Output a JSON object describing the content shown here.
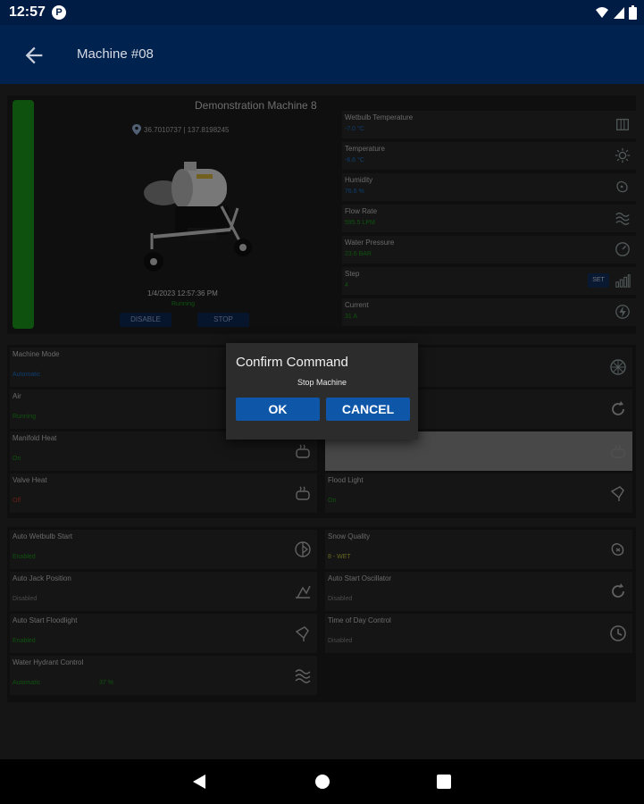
{
  "status_bar": {
    "time": "12:57",
    "app_badge": "P"
  },
  "app_bar": {
    "title": "Machine #08"
  },
  "machine": {
    "name": "Demonstration Machine 8",
    "coordinates": "36.7010737 | 137.8198245",
    "datetime": "1/4/2023 12:57:36 PM",
    "status": "Running",
    "disable_label": "DISABLE",
    "stop_label": "STOP"
  },
  "sensors": [
    {
      "label": "Wetbulb Temperature",
      "value": "-7.0 °C",
      "icon": "snowflake-icon",
      "color": "#1976d2"
    },
    {
      "label": "Temperature",
      "value": "-6.6 °C",
      "icon": "sun-icon",
      "color": "#1976d2"
    },
    {
      "label": "Humidity",
      "value": "76.6 %",
      "icon": "humidity-icon",
      "color": "#1976d2"
    },
    {
      "label": "Flow Rate",
      "value": "595.5 LPM",
      "icon": "waves-icon",
      "color": "#1c9c1c"
    },
    {
      "label": "Water Pressure",
      "value": "23.6 BAR",
      "icon": "gauge-icon",
      "color": "#1c9c1c"
    },
    {
      "label": "Step",
      "value": "4",
      "icon": "bars-icon",
      "color": "#1c9c1c",
      "button": "SET"
    },
    {
      "label": "Current",
      "value": "31 A",
      "icon": "bolt-icon",
      "color": "#1c9c1c"
    }
  ],
  "modes": [
    {
      "label": "Machine Mode",
      "value": "Automatic",
      "icon": "gear-icon",
      "color": "#1976d2"
    },
    {
      "label": "",
      "value": "",
      "icon": "fan-icon",
      "color": "#1976d2"
    },
    {
      "label": "Air",
      "value": "Running",
      "icon": "air-icon",
      "color": "#1c9c1c"
    },
    {
      "label": "",
      "value": "",
      "icon": "refresh-icon",
      "color": "#1c9c1c"
    },
    {
      "label": "Manifold Heat",
      "value": "On",
      "icon": "heat-icon",
      "color": "#1c9c1c"
    },
    {
      "label": "",
      "value": "",
      "icon": "heat-icon",
      "color": "#1c9c1c"
    },
    {
      "label": "Valve Heat",
      "value": "Off",
      "icon": "heat-icon",
      "color": "#c0392b"
    },
    {
      "label": "Flood Light",
      "value": "On",
      "icon": "lightbulb-icon",
      "color": "#1c9c1c"
    }
  ],
  "autos": [
    {
      "label": "Auto Wetbulb Start",
      "value": "Enabled",
      "icon": "wetbulb-icon",
      "color": "#1c9c1c"
    },
    {
      "label": "Snow Quality",
      "value": "8 - WET",
      "icon": "snow-quality-icon",
      "color": "#c9c23a"
    },
    {
      "label": "Auto Jack Position",
      "value": "Disabled",
      "icon": "jack-icon",
      "color": "#8c8c8c"
    },
    {
      "label": "Auto Start Oscillator",
      "value": "Disabled",
      "icon": "oscillator-icon",
      "color": "#8c8c8c"
    },
    {
      "label": "Auto Start Floodlight",
      "value": "Enabled",
      "icon": "lightbulb-icon",
      "color": "#1c9c1c"
    },
    {
      "label": "Time of Day Control",
      "value": "Disabled",
      "icon": "clock-icon",
      "color": "#8c8c8c"
    },
    {
      "label": "Water Hydrant Control",
      "value": "Automatic",
      "value2": "37 %",
      "icon": "waves-icon",
      "color": "#1c9c1c"
    }
  ],
  "dialog": {
    "title": "Confirm Command",
    "message": "Stop Machine",
    "ok_label": "OK",
    "cancel_label": "CANCEL"
  }
}
